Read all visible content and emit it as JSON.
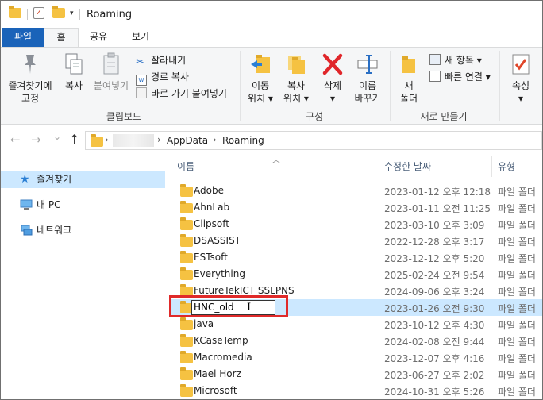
{
  "titlebar": {
    "title": "Roaming",
    "qat_dropdown": "▾"
  },
  "tabs": [
    {
      "label": "파일"
    },
    {
      "label": "홈"
    },
    {
      "label": "공유"
    },
    {
      "label": "보기"
    }
  ],
  "ribbon": {
    "clipboard": {
      "pin_label": "즐겨찾기에\n고정",
      "copy_label": "복사",
      "paste_label": "붙여넣기",
      "cut_label": "잘라내기",
      "copy_path_label": "경로 복사",
      "paste_shortcut_label": "바로 가기 붙여넣기",
      "group_label": "클립보드"
    },
    "organize": {
      "move_label": "이동\n위치 ▾",
      "copyto_label": "복사\n위치 ▾",
      "delete_label": "삭제\n▾",
      "rename_label": "이름\n바꾸기",
      "group_label": "구성"
    },
    "new": {
      "new_folder_label": "새\n폴더",
      "new_item_label": "새 항목 ▾",
      "easy_access_label": "빠른 연결 ▾",
      "group_label": "새로 만들기"
    },
    "open": {
      "properties_label": "속성\n▾"
    }
  },
  "address": {
    "segments": [
      "AppData",
      "Roaming"
    ],
    "chevron": "›"
  },
  "nav": {
    "back": "←",
    "forward": "→",
    "recent": "⌄",
    "up": "↑"
  },
  "navpane": {
    "items": [
      {
        "label": "즐겨찾기",
        "icon": "star-icon"
      },
      {
        "label": "내 PC",
        "icon": "pc-icon"
      },
      {
        "label": "네트워크",
        "icon": "network-icon"
      }
    ]
  },
  "columns": {
    "name": "이름",
    "date": "수정한 날짜",
    "type": "유형"
  },
  "files": [
    {
      "name": "Adobe",
      "date": "2023-01-12 오후 12:18",
      "type": "파일 폴더"
    },
    {
      "name": "AhnLab",
      "date": "2023-01-11 오전 11:25",
      "type": "파일 폴더"
    },
    {
      "name": "Clipsoft",
      "date": "2023-03-10 오후 3:09",
      "type": "파일 폴더"
    },
    {
      "name": "DSASSIST",
      "date": "2022-12-28 오후 3:17",
      "type": "파일 폴더"
    },
    {
      "name": "ESTsoft",
      "date": "2023-12-12 오후 5:20",
      "type": "파일 폴더"
    },
    {
      "name": "Everything",
      "date": "2025-02-24 오전 9:54",
      "type": "파일 폴더"
    },
    {
      "name": "FutureTekICT SSLPNS",
      "date": "2024-09-06 오후 3:24",
      "type": "파일 폴더"
    },
    {
      "name": "HNC_old",
      "date": "2023-01-26 오전 9:30",
      "type": "파일 폴더",
      "editing": true
    },
    {
      "name": "java",
      "date": "2023-10-12 오후 4:30",
      "type": "파일 폴더"
    },
    {
      "name": "KCaseTemp",
      "date": "2024-02-08 오전 9:44",
      "type": "파일 폴더"
    },
    {
      "name": "Macromedia",
      "date": "2023-12-07 오후 4:16",
      "type": "파일 폴더"
    },
    {
      "name": "Mael Horz",
      "date": "2023-06-27 오후 2:02",
      "type": "파일 폴더"
    },
    {
      "name": "Microsoft",
      "date": "2024-10-31 오후 5:26",
      "type": "파일 폴더"
    }
  ],
  "rename_value": "HNC_old",
  "colors": {
    "file_tab": "#1a63b9",
    "selection": "#cce8ff",
    "folder": "#f5c242",
    "highlight_box": "#e02a2a"
  }
}
